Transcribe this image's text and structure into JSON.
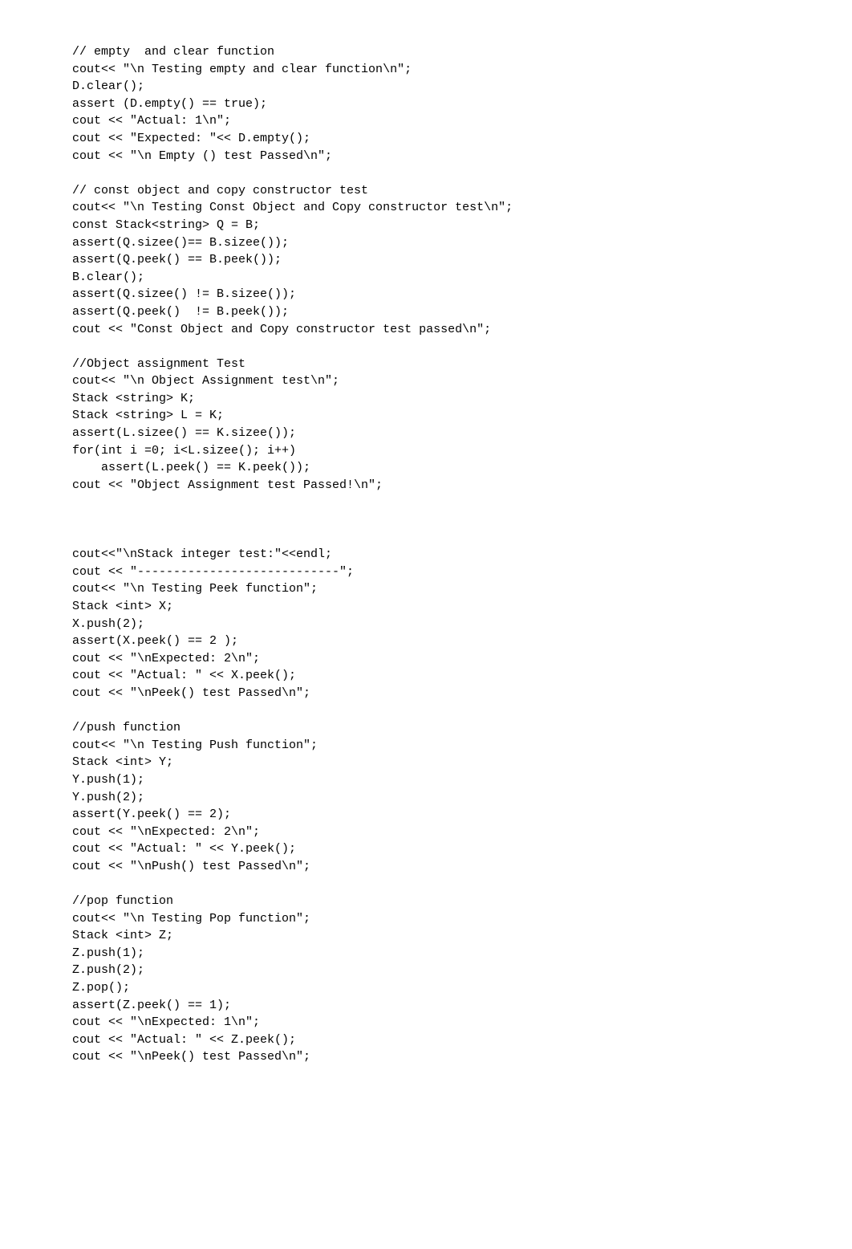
{
  "code": "// empty  and clear function\ncout<< \"\\n Testing empty and clear function\\n\";\nD.clear();\nassert (D.empty() == true);\ncout << \"Actual: 1\\n\";\ncout << \"Expected: \"<< D.empty();\ncout << \"\\n Empty () test Passed\\n\";\n\n// const object and copy constructor test\ncout<< \"\\n Testing Const Object and Copy constructor test\\n\";\nconst Stack<string> Q = B;\nassert(Q.sizee()== B.sizee());\nassert(Q.peek() == B.peek());\nB.clear();\nassert(Q.sizee() != B.sizee());\nassert(Q.peek()  != B.peek());\ncout << \"Const Object and Copy constructor test passed\\n\";\n\n//Object assignment Test\ncout<< \"\\n Object Assignment test\\n\";\nStack <string> K;\nStack <string> L = K;\nassert(L.sizee() == K.sizee());\nfor(int i =0; i<L.sizee(); i++)\n    assert(L.peek() == K.peek());\ncout << \"Object Assignment test Passed!\\n\";\n\n\n\ncout<<\"\\nStack integer test:\"<<endl;\ncout << \"----------------------------\";\ncout<< \"\\n Testing Peek function\";\nStack <int> X;\nX.push(2);\nassert(X.peek() == 2 );\ncout << \"\\nExpected: 2\\n\";\ncout << \"Actual: \" << X.peek();\ncout << \"\\nPeek() test Passed\\n\";\n\n//push function\ncout<< \"\\n Testing Push function\";\nStack <int> Y;\nY.push(1);\nY.push(2);\nassert(Y.peek() == 2);\ncout << \"\\nExpected: 2\\n\";\ncout << \"Actual: \" << Y.peek();\ncout << \"\\nPush() test Passed\\n\";\n\n//pop function\ncout<< \"\\n Testing Pop function\";\nStack <int> Z;\nZ.push(1);\nZ.push(2);\nZ.pop();\nassert(Z.peek() == 1);\ncout << \"\\nExpected: 1\\n\";\ncout << \"Actual: \" << Z.peek();\ncout << \"\\nPeek() test Passed\\n\";"
}
